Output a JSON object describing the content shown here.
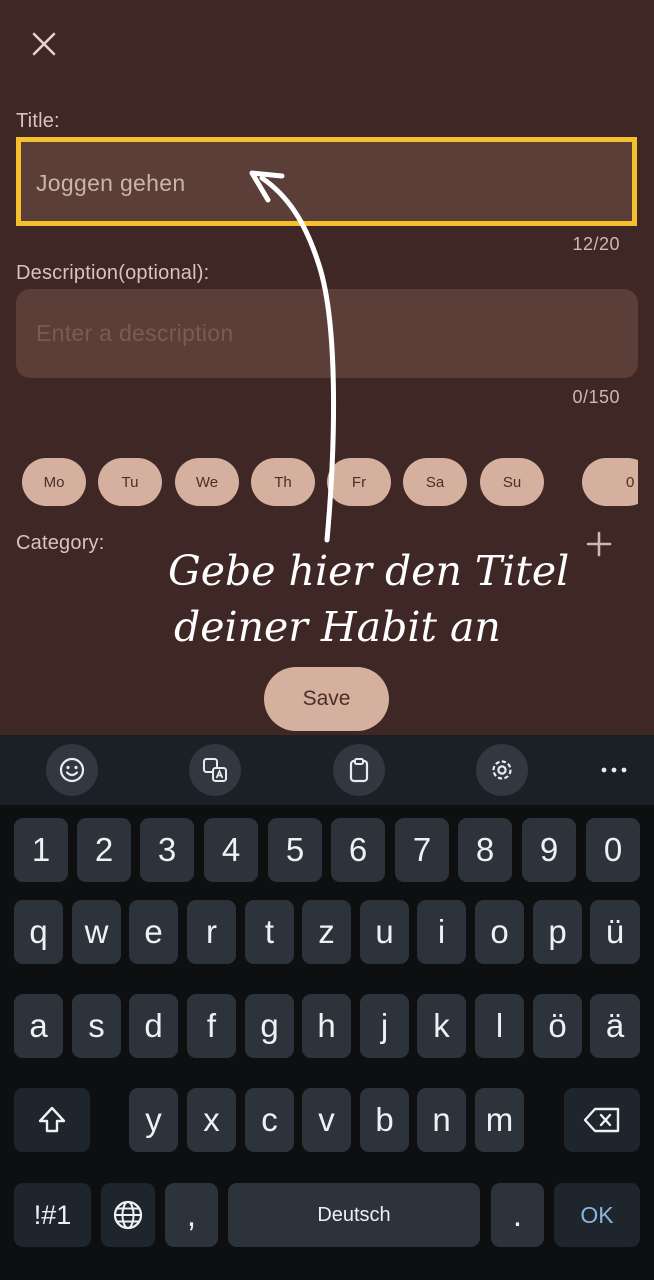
{
  "form": {
    "title_label": "Title:",
    "title_value": "Joggen gehen",
    "title_counter": "12/20",
    "description_label": "Description(optional):",
    "description_placeholder": "Enter a description",
    "description_counter": "0/150",
    "days": [
      "Mo",
      "Tu",
      "We",
      "Th",
      "Fr",
      "Sa",
      "Su"
    ],
    "extra_chip_label": "0",
    "category_label": "Category:",
    "save_label": "Save",
    "highlight_color": "#f5c02e"
  },
  "annotation": {
    "line1": "Gebe hier den Titel",
    "line2": "deiner Habit an"
  },
  "icons": {
    "close": "close-icon",
    "add": "plus-icon",
    "toolbar": [
      "emoji-icon",
      "translate-icon",
      "clipboard-icon",
      "settings-icon",
      "more-icon"
    ]
  },
  "keyboard": {
    "row_numbers": [
      "1",
      "2",
      "3",
      "4",
      "5",
      "6",
      "7",
      "8",
      "9",
      "0"
    ],
    "row1": [
      "q",
      "w",
      "e",
      "r",
      "t",
      "z",
      "u",
      "i",
      "o",
      "p",
      "ü"
    ],
    "row2": [
      "a",
      "s",
      "d",
      "f",
      "g",
      "h",
      "j",
      "k",
      "l",
      "ö",
      "ä"
    ],
    "row3": [
      "y",
      "x",
      "c",
      "v",
      "b",
      "n",
      "m"
    ],
    "symbols_label": "!#1",
    "comma_label": ",",
    "space_label": "Deutsch",
    "period_label": ".",
    "ok_label": "OK"
  }
}
